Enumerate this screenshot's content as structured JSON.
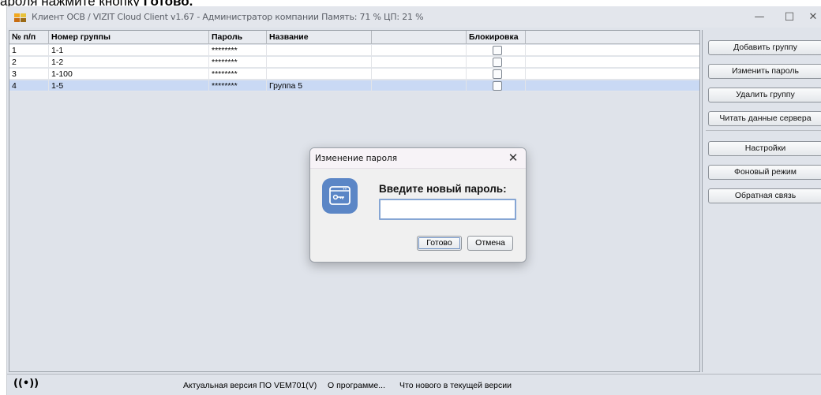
{
  "doc_fragment": {
    "text": "арoля нажмите кнопку ",
    "bold": "Готово."
  },
  "window": {
    "title": "Клиент ОСВ / VIZIT Cloud Client v1.67 - Администратор компании     Память: 71 %  ЦП: 21 %",
    "controls": {
      "minimize": "—",
      "maximize": "☐",
      "close": "✕"
    }
  },
  "table": {
    "headers": [
      "№ п/п",
      "Номер группы",
      "Пароль",
      "Название",
      "",
      "Блокировка",
      ""
    ],
    "rows": [
      {
        "num": "1",
        "group": "1-1",
        "password": "********",
        "name": "",
        "locked": false,
        "selected": false
      },
      {
        "num": "2",
        "group": "1-2",
        "password": "********",
        "name": "",
        "locked": false,
        "selected": false
      },
      {
        "num": "3",
        "group": "1-100",
        "password": "********",
        "name": "",
        "locked": false,
        "selected": false
      },
      {
        "num": "4",
        "group": "1-5",
        "password": "********",
        "name": "Группа 5",
        "locked": false,
        "selected": true
      }
    ]
  },
  "right_panel": {
    "add_group": "Добавить группу",
    "change_password": "Изменить пароль",
    "delete_group": "Удалить группу",
    "read_server_data": "Читать данные сервера",
    "settings": "Настройки",
    "background_mode": "Фоновый режим",
    "feedback": "Обратная связь"
  },
  "statusbar": {
    "icon": "((•))",
    "actual_version": "Актуальная версия ПО VEM701(V)",
    "about": "О программе...",
    "whats_new": "Что нового в текущей версии"
  },
  "dialog": {
    "title": "Изменение пароля",
    "close": "✕",
    "prompt": "Введите новый пароль:",
    "password_value": "",
    "ok": "Готово",
    "cancel": "Отмена",
    "icon": "key-window-icon"
  },
  "colors": {
    "selected_row": "#c9d9f4",
    "dialog_icon": "#5b86c6",
    "input_border": "#86a6d4"
  }
}
